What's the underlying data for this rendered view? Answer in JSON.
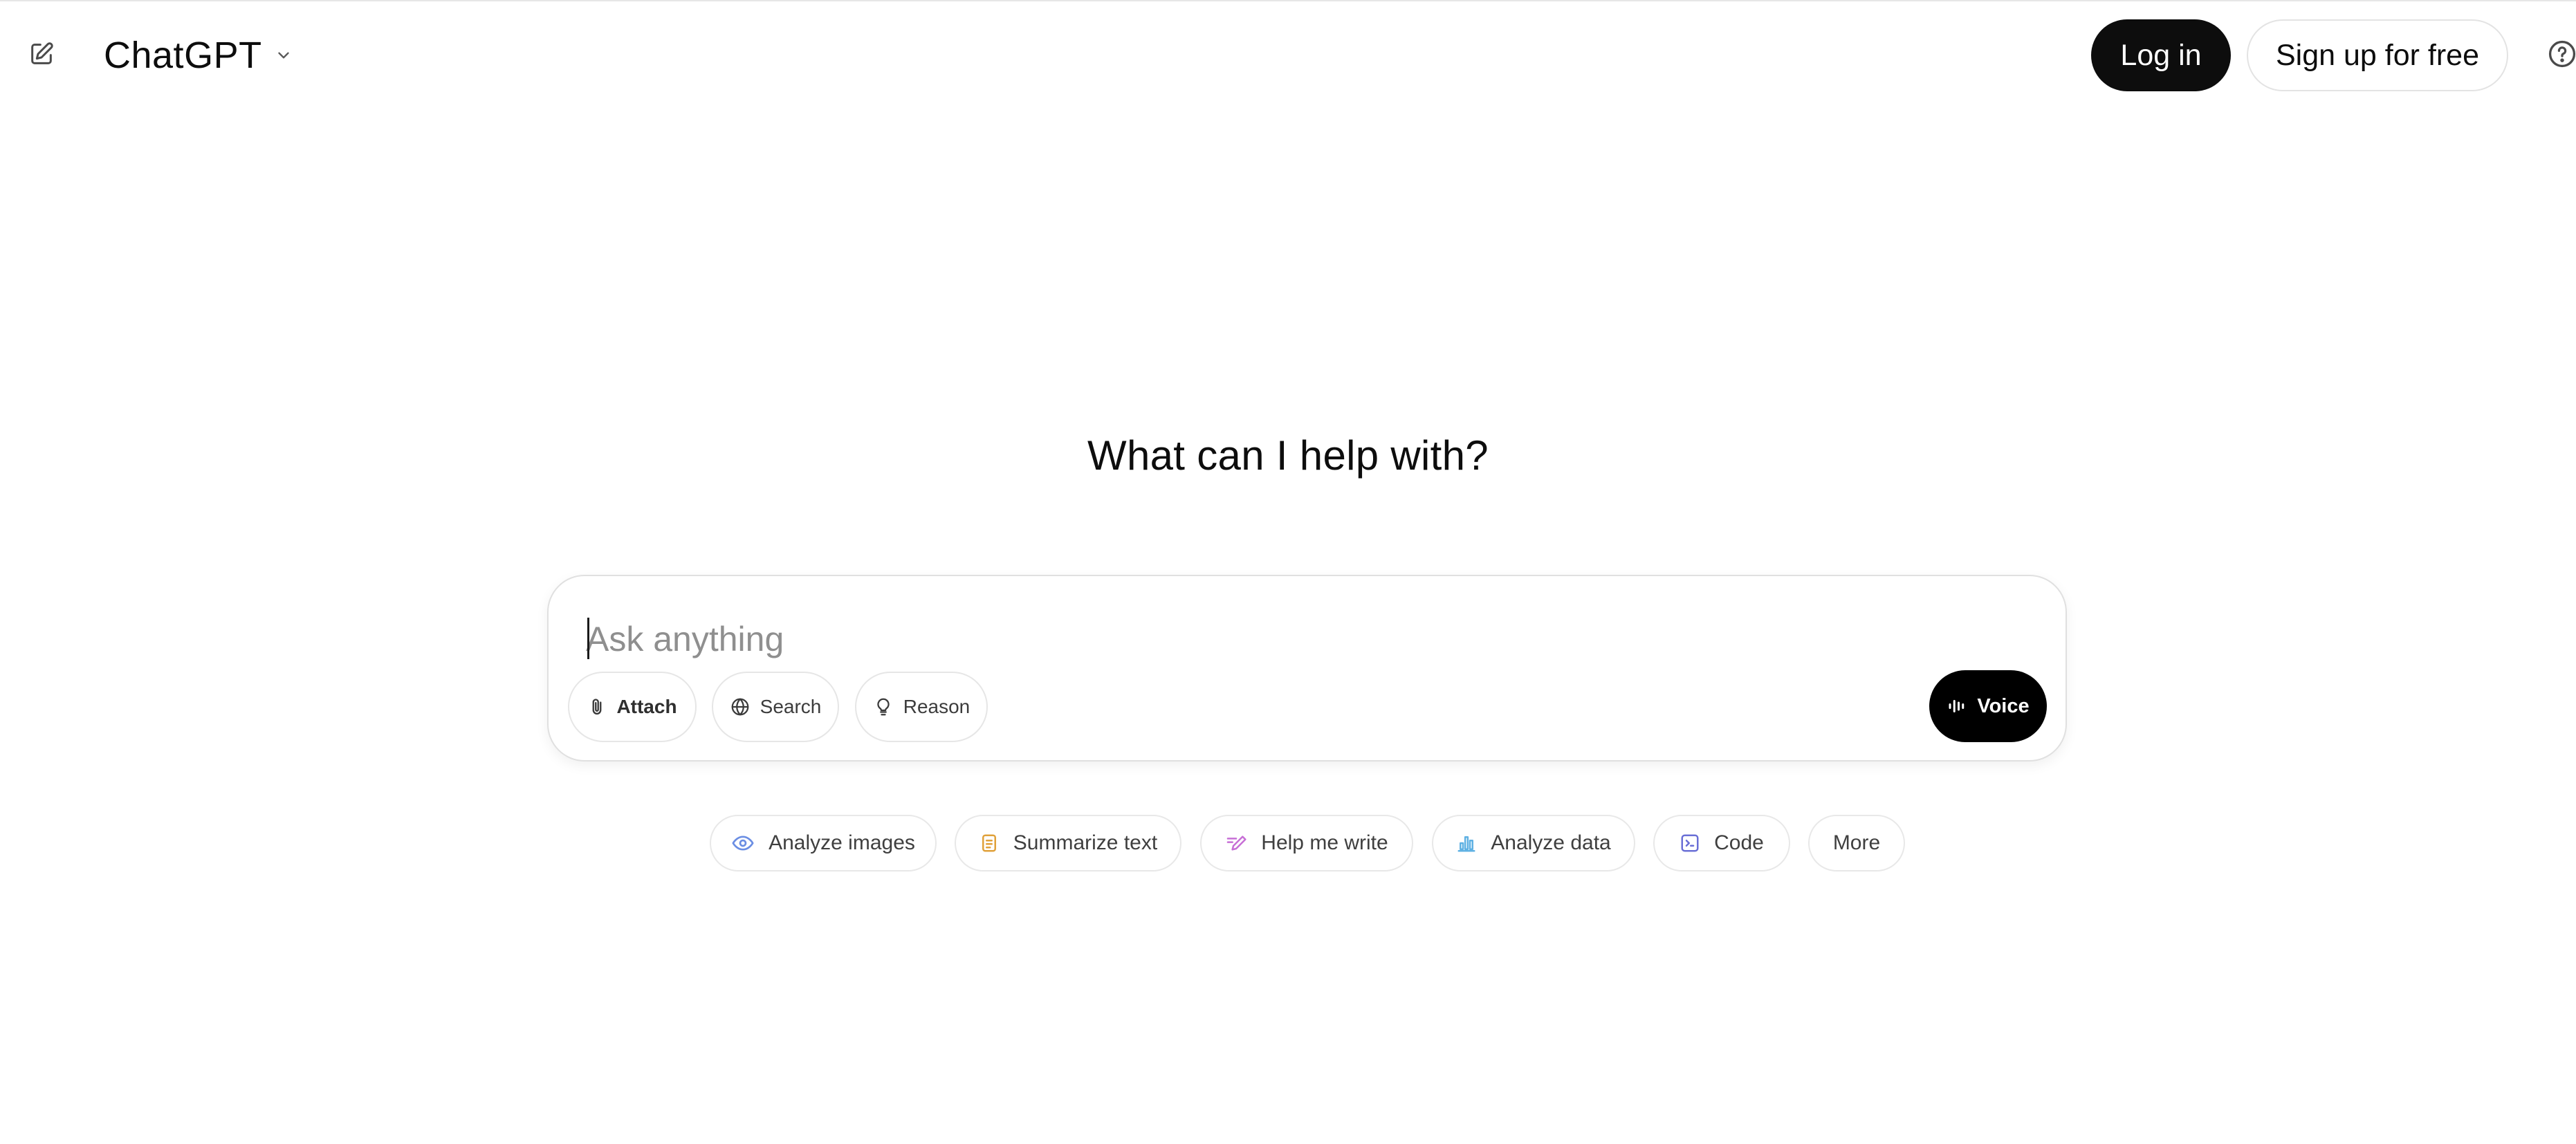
{
  "header": {
    "new_chat_icon": "pencil-square-icon",
    "model_name": "ChatGPT",
    "model_dropdown_icon": "chevron-down-icon",
    "login_label": "Log in",
    "signup_label": "Sign up for free",
    "help_icon": "question-circle-icon"
  },
  "main": {
    "heading": "What can I help with?",
    "composer": {
      "placeholder": "Ask anything",
      "value": "",
      "tools": [
        {
          "label": "Attach",
          "icon": "paperclip-icon"
        },
        {
          "label": "Search",
          "icon": "globe-icon"
        },
        {
          "label": "Reason",
          "icon": "lightbulb-icon"
        }
      ],
      "voice_label": "Voice",
      "voice_icon": "waveform-icon"
    },
    "suggestions": [
      {
        "label": "Analyze images",
        "icon": "eye-icon",
        "color": "#6b8ee3"
      },
      {
        "label": "Summarize text",
        "icon": "document-icon",
        "color": "#e0a13a"
      },
      {
        "label": "Help me write",
        "icon": "pen-icon",
        "color": "#c76fd6"
      },
      {
        "label": "Analyze data",
        "icon": "bar-chart-icon",
        "color": "#5fb1e3"
      },
      {
        "label": "Code",
        "icon": "code-icon",
        "color": "#6a6fd6"
      },
      {
        "label": "More",
        "icon": ""
      }
    ]
  },
  "colors": {
    "primary_button": "#0d0d0d",
    "border": "#e3e3e3",
    "placeholder": "#8f8f8f"
  }
}
